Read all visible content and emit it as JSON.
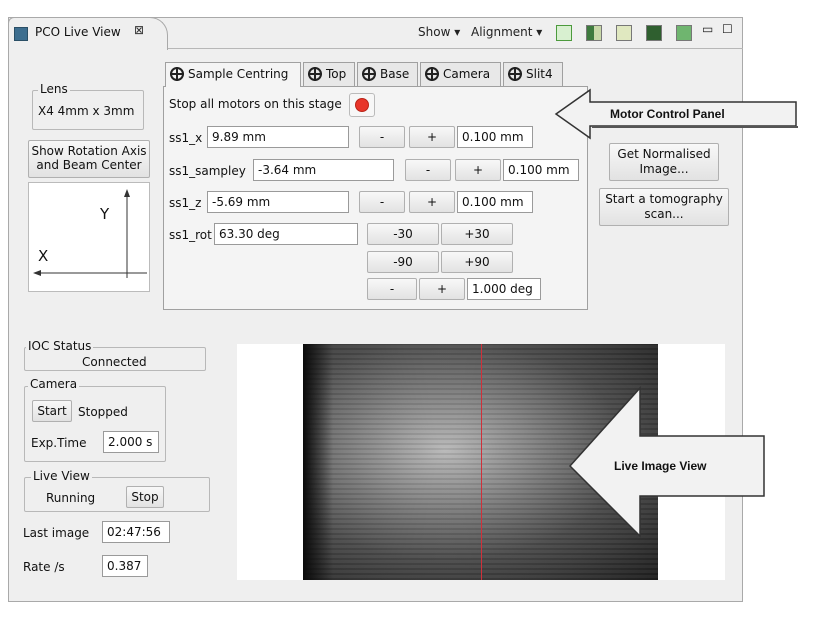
{
  "view": {
    "title": "PCO Live View",
    "close_glyph": "⊠",
    "show_menu": "Show ▾",
    "alignment_menu": "Alignment ▾",
    "minimize_glyph": "▭",
    "maximize_glyph": "☐"
  },
  "lens": {
    "group_label": "Lens",
    "value": "X4 4mm x 3mm"
  },
  "rotation": {
    "button_label": "Show Rotation Axis and Beam Center",
    "y_label": "Y",
    "x_label": "X"
  },
  "tabs": [
    {
      "label": "Sample Centring"
    },
    {
      "label": "Top"
    },
    {
      "label": "Base"
    },
    {
      "label": "Camera"
    },
    {
      "label": "Slit4"
    }
  ],
  "motors": {
    "stop_all_label": "Stop all motors on this stage",
    "ss1_x": {
      "label": "ss1_x",
      "value": "9.89 mm",
      "minus": "-",
      "plus": "+",
      "step": "0.100 mm"
    },
    "ss1_sampley": {
      "label": "ss1_sampley",
      "value": "-3.64 mm",
      "minus": "-",
      "plus": "+",
      "step": "0.100 mm"
    },
    "ss1_z": {
      "label": "ss1_z",
      "value": "-5.69 mm",
      "minus": "-",
      "plus": "+",
      "step": "0.100 mm"
    },
    "ss1_rot": {
      "label": "ss1_rot",
      "value": "63.30 deg",
      "m30": "-30",
      "p30": "+30",
      "m90": "-90",
      "p90": "+90",
      "minus": "-",
      "plus": "+",
      "step": "1.000 deg"
    }
  },
  "right_buttons": {
    "normalised": "Get Normalised Image...",
    "tomography": "Start a tomography scan..."
  },
  "ioc": {
    "group_label": "IOC Status",
    "value": "Connected"
  },
  "camera": {
    "group_label": "Camera",
    "start": "Start",
    "state": "Stopped",
    "exp_label": "Exp.Time",
    "exp_value": "2.000 s"
  },
  "liveview": {
    "group_label": "Live View",
    "state": "Running",
    "stop": "Stop"
  },
  "last_image": {
    "label": "Last image",
    "value": "02:47:56"
  },
  "rate": {
    "label": "Rate /s",
    "value": "0.387"
  },
  "callouts": {
    "motor": "Motor Control Panel",
    "live": "Live Image View"
  },
  "colors": {
    "stop_button": "#e8352a",
    "panel_bg": "#efefef",
    "callout_fill": "#f2f2f2"
  }
}
